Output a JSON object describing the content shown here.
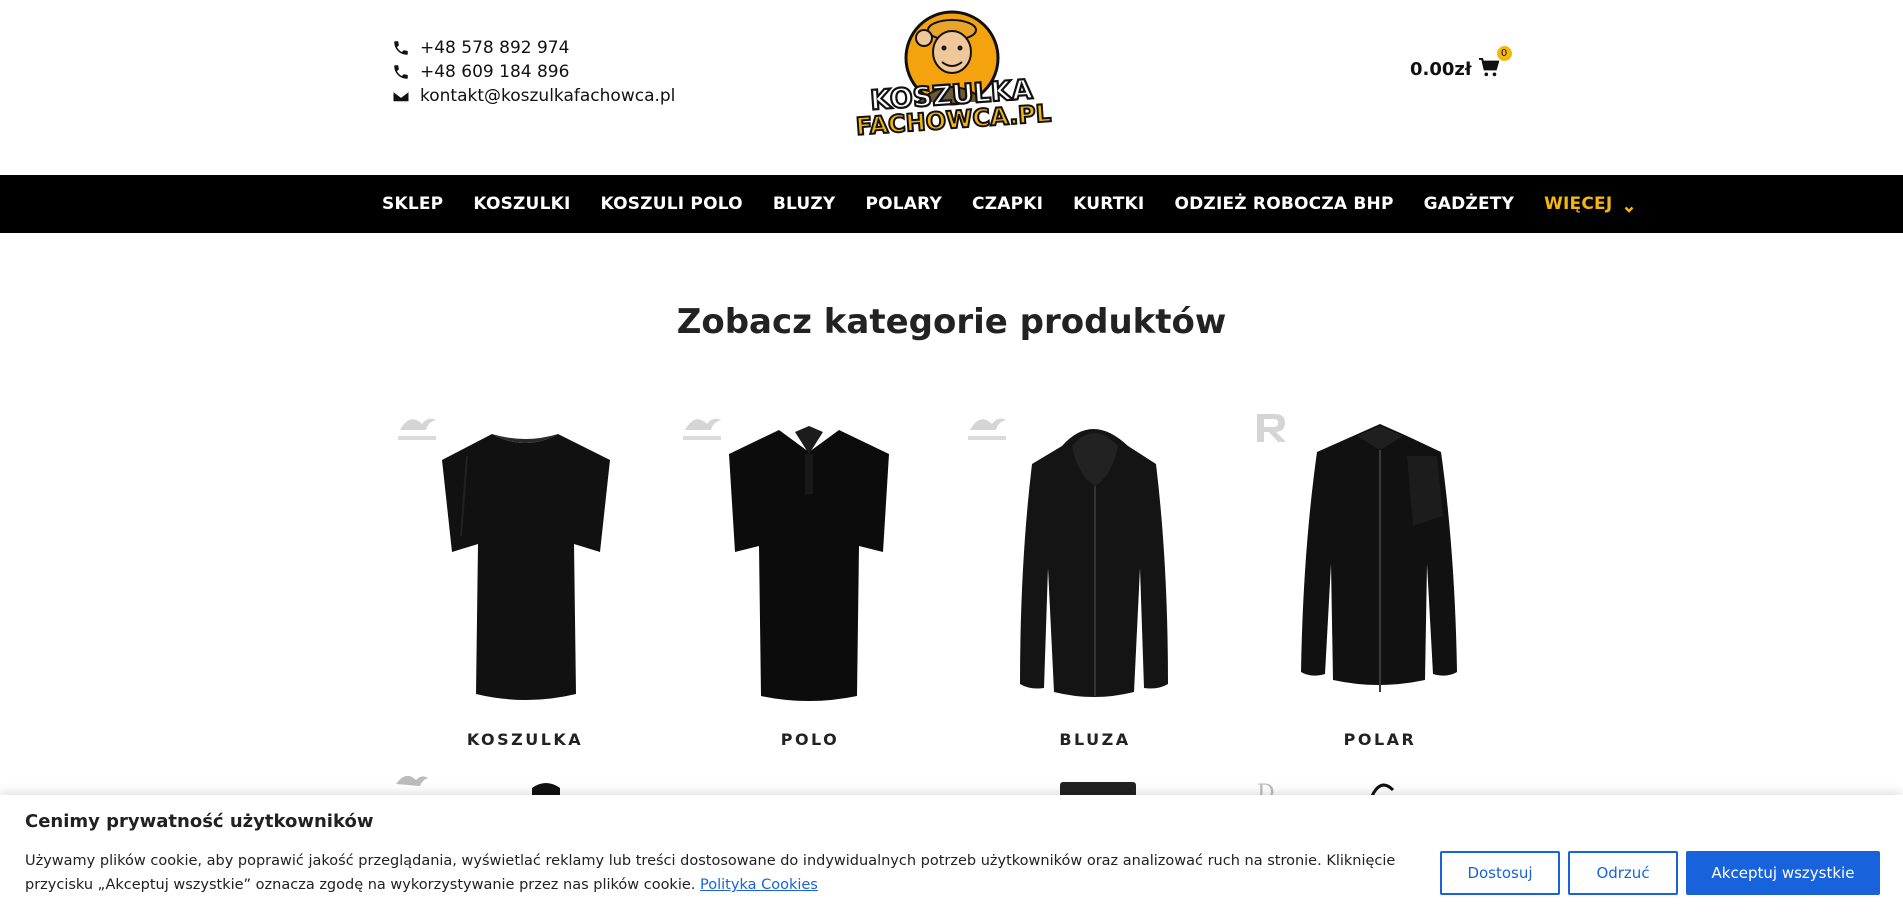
{
  "contacts": {
    "phone1": "+48 578 892 974",
    "phone2": "+48 609 184 896",
    "email": "kontakt@koszulkafachowca.pl"
  },
  "logo": {
    "line1": "KOSZULKA",
    "line2": "FACHOWCA.PL"
  },
  "cart": {
    "total": "0.00zł",
    "count": "0"
  },
  "nav": {
    "items": [
      "SKLEP",
      "KOSZULKI",
      "KOSZULI POLO",
      "BLUZY",
      "POLARY",
      "CZAPKI",
      "KURTKI",
      "ODZIEŻ ROBOCZA BHP",
      "GADŻETY"
    ],
    "more": "WIĘCEJ"
  },
  "section": {
    "title": "Zobacz kategorie produktów"
  },
  "products": [
    {
      "name": "KOSZULKA",
      "brand": "MALFINI"
    },
    {
      "name": "POLO",
      "brand": "MALFINI"
    },
    {
      "name": "BLUZA",
      "brand": "MALFINI"
    },
    {
      "name": "POLAR",
      "brand": "R"
    }
  ],
  "cookie": {
    "title": "Cenimy prywatność użytkowników",
    "text": "Używamy plików cookie, aby poprawić jakość przeglądania, wyświetlać reklamy lub treści dostosowane do indywidualnych potrzeb użytkowników oraz analizować ruch na stronie. Kliknięcie przycisku „Akceptuj wszystkie” oznacza zgodę na wykorzystywanie przez nas plików cookie.",
    "link": "Polityka Cookies",
    "customize": "Dostosuj",
    "reject": "Odrzuć",
    "accept": "Akceptuj wszystkie"
  },
  "colors": {
    "accent": "#f5b60f",
    "nav_bg": "#000000",
    "cookie_blue": "#1863dc"
  },
  "icons": [
    "phone-icon",
    "envelope-icon",
    "cart-icon",
    "chevron-down-icon"
  ]
}
